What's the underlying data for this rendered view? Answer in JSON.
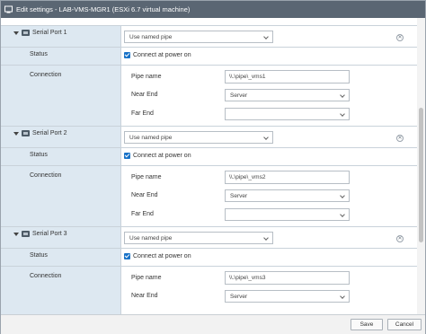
{
  "window": {
    "title": "Edit settings - LAB-VMS-MGR1 (ESXi 6.7 virtual machine)"
  },
  "ports": [
    {
      "name": "Serial Port 1",
      "type_value": "Use named pipe",
      "status_label": "Status",
      "status_checkbox": "Connect at power on",
      "connection_label": "Connection",
      "pipe_name_label": "Pipe name",
      "pipe_name_value": "\\\\.\\pipe\\_vms1",
      "near_end_label": "Near End",
      "near_end_value": "Server",
      "far_end_label": "Far End",
      "far_end_value": ""
    },
    {
      "name": "Serial Port 2",
      "type_value": "Use named pipe",
      "status_label": "Status",
      "status_checkbox": "Connect at power on",
      "connection_label": "Connection",
      "pipe_name_label": "Pipe name",
      "pipe_name_value": "\\\\.\\pipe\\_vms2",
      "near_end_label": "Near End",
      "near_end_value": "Server",
      "far_end_label": "Far End",
      "far_end_value": ""
    },
    {
      "name": "Serial Port 3",
      "type_value": "Use named pipe",
      "status_label": "Status",
      "status_checkbox": "Connect at power on",
      "connection_label": "Connection",
      "pipe_name_label": "Pipe name",
      "pipe_name_value": "\\\\.\\pipe\\_vms3",
      "near_end_label": "Near End",
      "near_end_value": "Server"
    }
  ],
  "icons": {
    "title": "vm-settings-icon",
    "port": "serial-port-icon",
    "remove": "remove-circle-icon",
    "expand": "caret-down-icon",
    "dropdown": "chevron-down-icon"
  },
  "remove_glyph": "✕",
  "footer": {
    "save_label": "Save",
    "cancel_label": "Cancel"
  },
  "colors": {
    "titlebar": "#5a6673",
    "label_column": "#dde8f1",
    "checkbox": "#1a73c8"
  }
}
